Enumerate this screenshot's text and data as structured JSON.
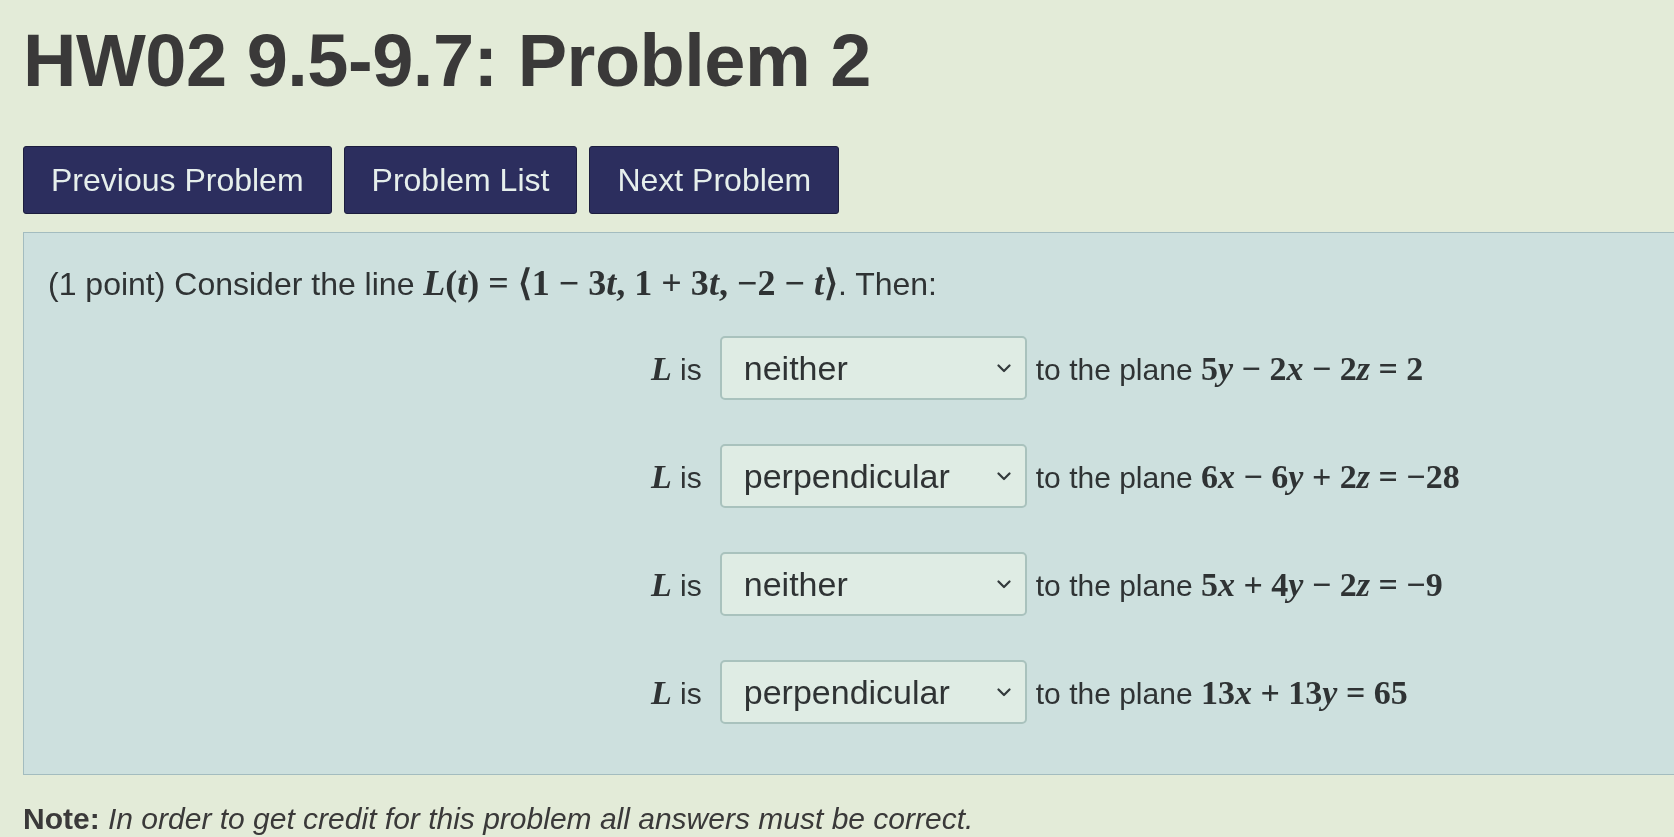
{
  "page": {
    "title": "HW02 9.5-9.7: Problem 2"
  },
  "nav_buttons": [
    {
      "label": "Previous Problem"
    },
    {
      "label": "Problem List"
    },
    {
      "label": "Next Problem"
    }
  ],
  "problem": {
    "statement": {
      "lead": "(1 point) Consider the line",
      "formula": "L(t) = ⟨1 − 3t, 1 + 3t, −2 − t⟩",
      "tail": ". Then:"
    },
    "rows": [
      {
        "variable": "L",
        "verb": "is",
        "answer": "neither",
        "lead": "to the plane",
        "equation": "5y − 2x − 2z = 2"
      },
      {
        "variable": "L",
        "verb": "is",
        "answer": "perpendicular",
        "lead": "to the plane",
        "equation": "6x − 6y + 2z = −28"
      },
      {
        "variable": "L",
        "verb": "is",
        "answer": "neither",
        "lead": "to the plane",
        "equation": "5x + 4y − 2z = −9"
      },
      {
        "variable": "L",
        "verb": "is",
        "answer": "perpendicular",
        "lead": "to the plane",
        "equation": "13x + 13y = 65"
      }
    ]
  },
  "note": "**Note:** *In order to get credit for this problem all answers must be correct.*"
}
